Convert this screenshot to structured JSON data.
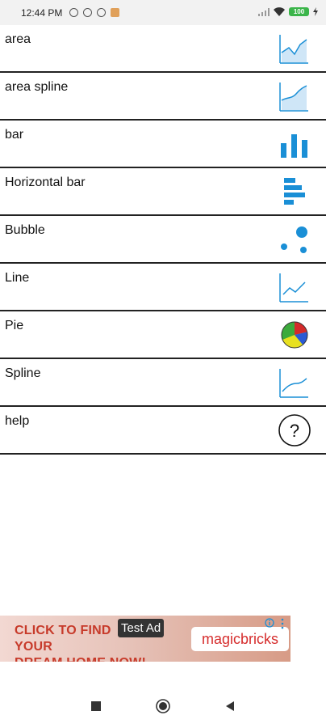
{
  "status_bar": {
    "time": "12:44 PM",
    "battery": "100",
    "icons": [
      "sync-off-icon",
      "circle-at-icon",
      "circle-at-icon",
      "shopping-bag-icon",
      "signal-icon",
      "wifi-icon",
      "battery-icon",
      "charging-bolt-icon"
    ]
  },
  "list": {
    "items": [
      {
        "label": "area",
        "icon": "area-chart-icon"
      },
      {
        "label": "area spline",
        "icon": "area-spline-chart-icon"
      },
      {
        "label": "bar",
        "icon": "bar-chart-icon"
      },
      {
        "label": "Horizontal bar",
        "icon": "horizontal-bar-chart-icon"
      },
      {
        "label": "Bubble",
        "icon": "bubble-chart-icon"
      },
      {
        "label": "Line",
        "icon": "line-chart-icon"
      },
      {
        "label": "Pie",
        "icon": "pie-chart-icon"
      },
      {
        "label": "Spline",
        "icon": "spline-chart-icon"
      },
      {
        "label": "help",
        "icon": "help-icon"
      }
    ]
  },
  "ad": {
    "headline_line1": "CLICK TO FIND YOUR",
    "headline_line2": "DREAM HOME NOW!",
    "badge": "Test Ad",
    "brand": "magicbricks",
    "colors": {
      "headline": "#c73a2a",
      "brand": "#d62d2d"
    }
  },
  "nav": {
    "buttons": [
      "recents-button",
      "home-button",
      "back-button"
    ]
  },
  "colors": {
    "icon_blue": "#1a8fd6",
    "divider": "#222222",
    "pie_green": "#3caa3c",
    "pie_yellow": "#e8e020",
    "pie_red": "#d42a2a",
    "pie_blue": "#2a5ad4"
  }
}
